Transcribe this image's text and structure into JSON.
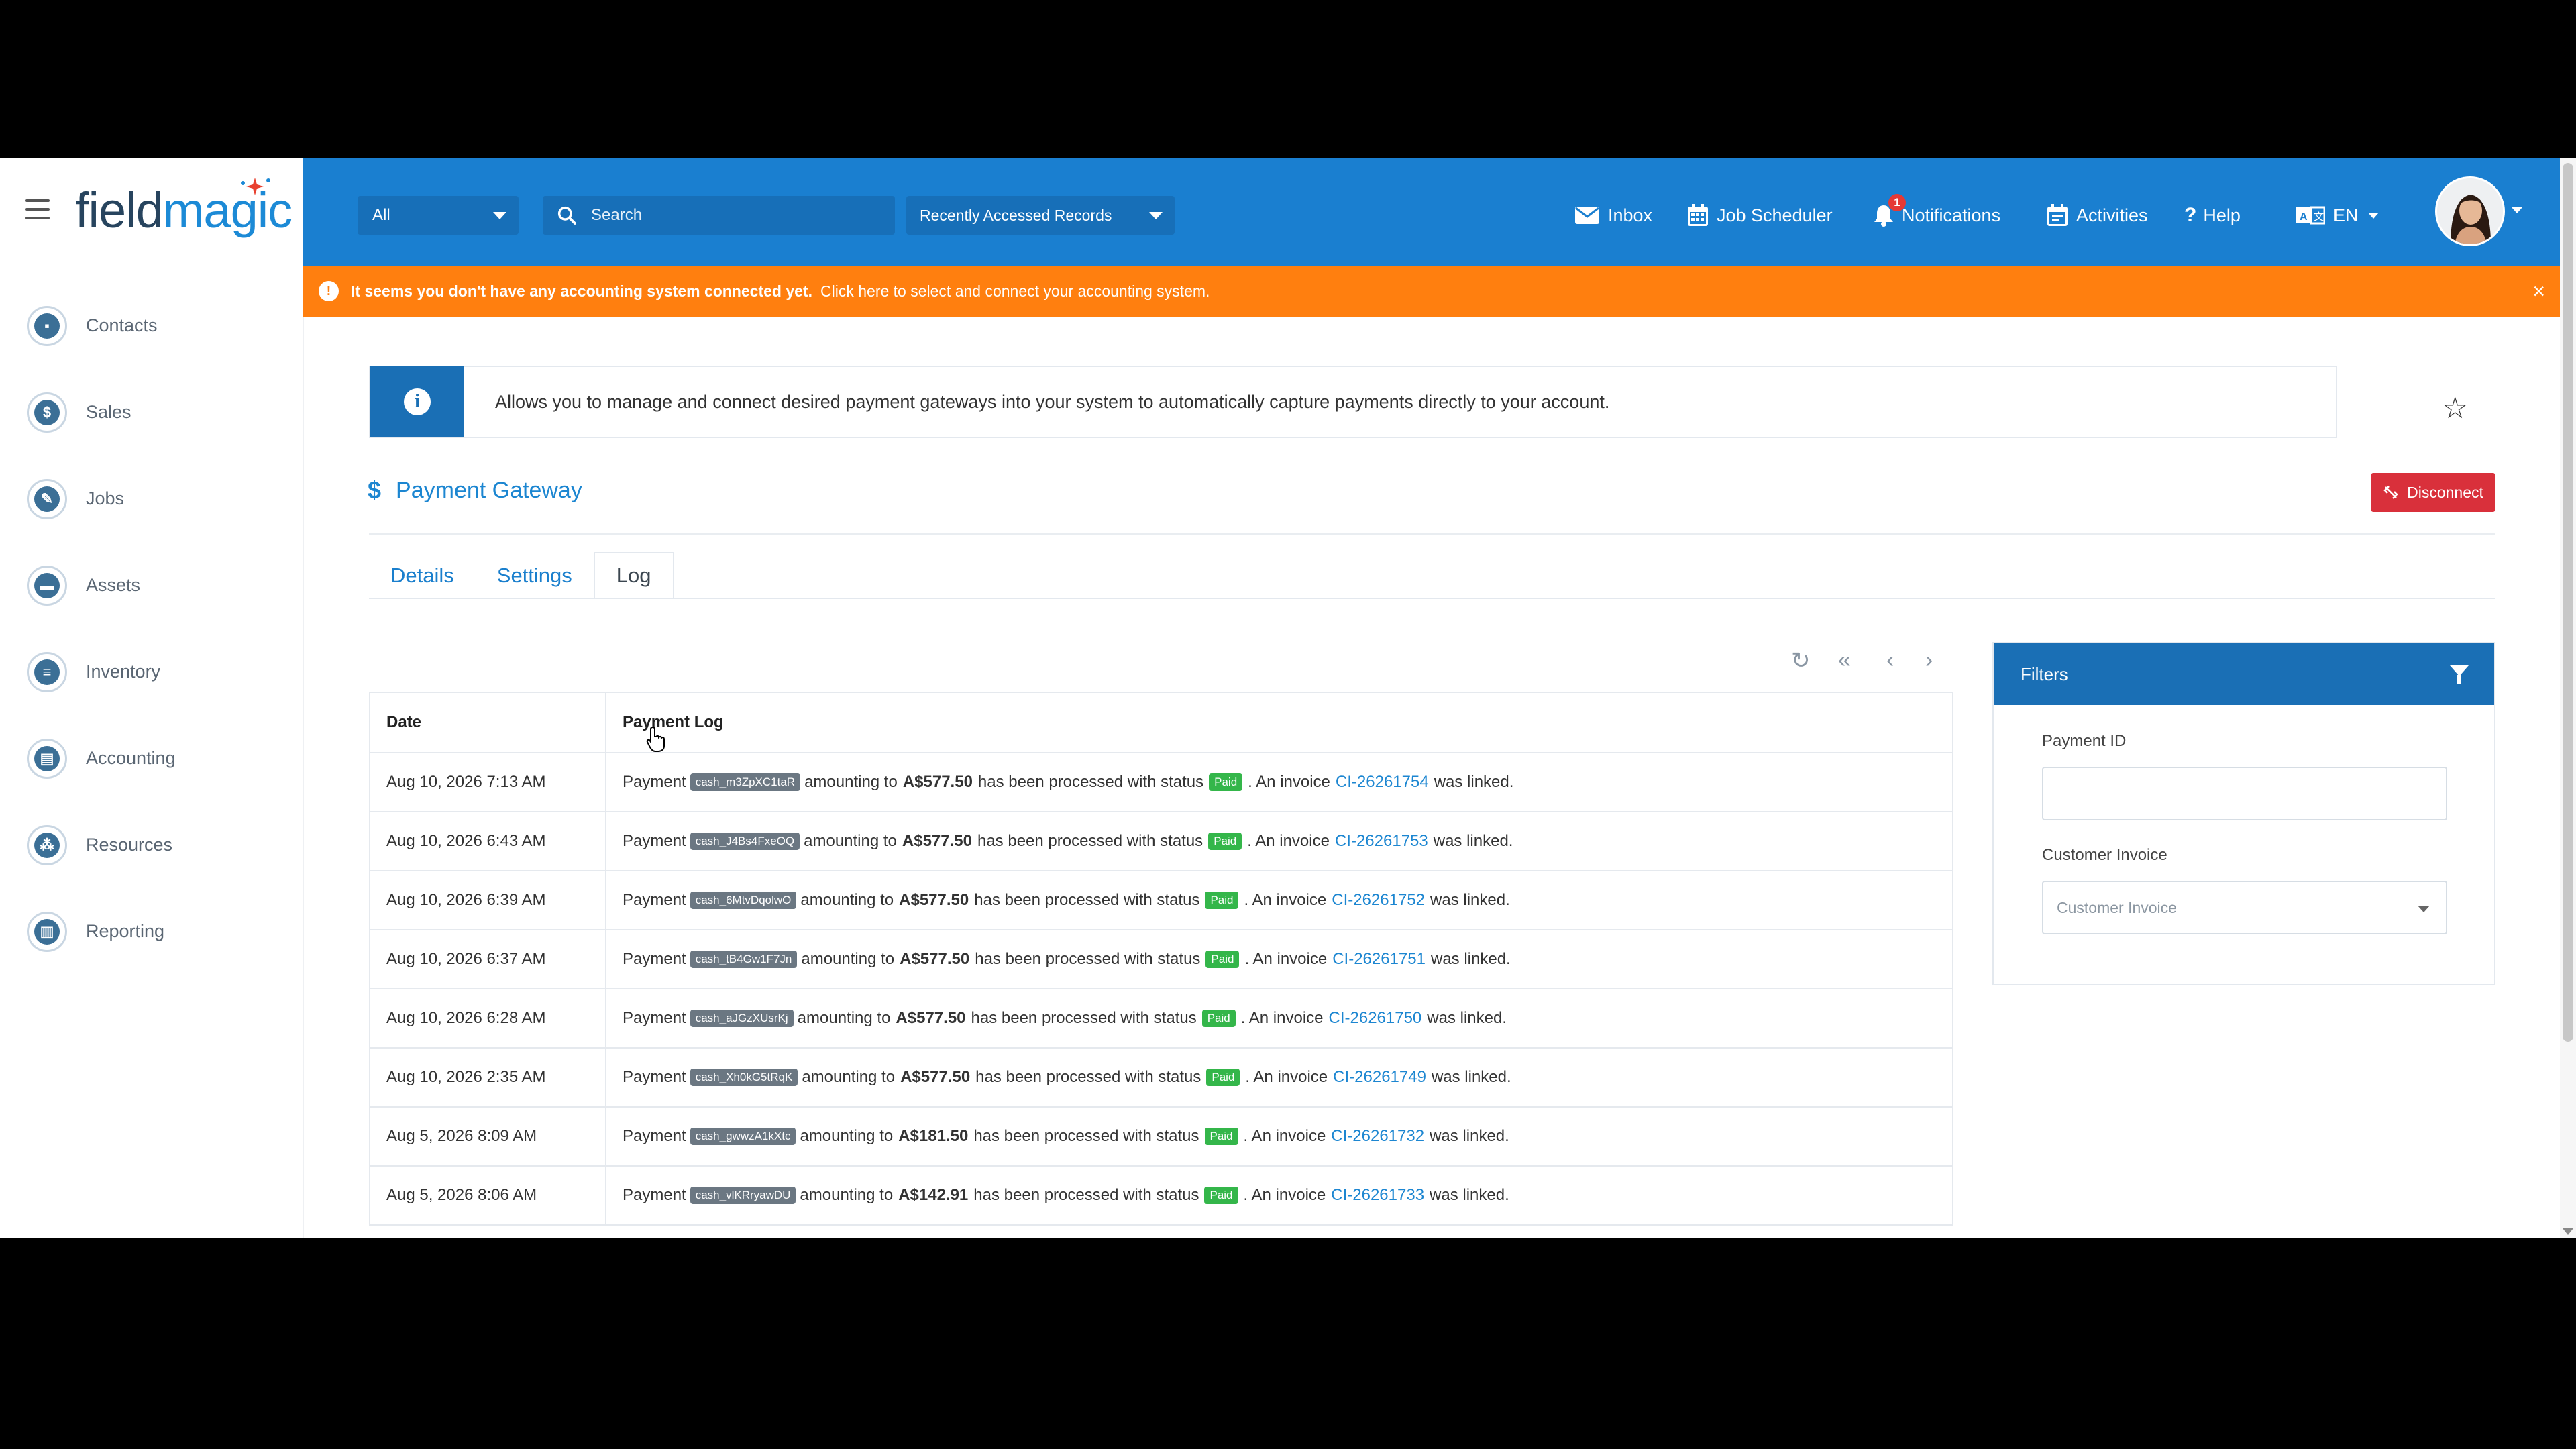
{
  "brand": {
    "logo_part1": "field",
    "logo_part2": "magic"
  },
  "sidebar": {
    "items": [
      {
        "label": "Contacts",
        "icon": "contacts-icon",
        "glyph": "▪"
      },
      {
        "label": "Sales",
        "icon": "dollar-icon",
        "glyph": "$"
      },
      {
        "label": "Jobs",
        "icon": "wrench-icon",
        "glyph": "✎"
      },
      {
        "label": "Assets",
        "icon": "briefcase-icon",
        "glyph": "▬"
      },
      {
        "label": "Inventory",
        "icon": "inventory-icon",
        "glyph": "≡"
      },
      {
        "label": "Accounting",
        "icon": "accounting-icon",
        "glyph": "▤"
      },
      {
        "label": "Resources",
        "icon": "resources-icon",
        "glyph": "⁂"
      },
      {
        "label": "Reporting",
        "icon": "reporting-icon",
        "glyph": "▥"
      }
    ]
  },
  "topbar": {
    "scope_select": "All",
    "search_placeholder": "Search",
    "recent_label": "Recently Accessed Records",
    "inbox": "Inbox",
    "job_scheduler": "Job Scheduler",
    "notifications": "Notifications",
    "notifications_count": "1",
    "activities": "Activities",
    "help": "Help",
    "language": "EN"
  },
  "alert": {
    "bold_text": "It seems you don't have any accounting system connected yet.",
    "link_text": "Click here to select and connect your accounting system.",
    "close": "×"
  },
  "info": {
    "text": "Allows you to manage and connect desired payment gateways into your system to automatically capture payments directly to your account."
  },
  "page": {
    "title": "Payment Gateway",
    "disconnect_label": "Disconnect"
  },
  "tabs": [
    {
      "label": "Details"
    },
    {
      "label": "Settings"
    },
    {
      "label": "Log"
    }
  ],
  "log_table": {
    "headers": {
      "date": "Date",
      "log": "Payment Log"
    },
    "rows": [
      {
        "date": "Aug 10, 2026 7:13 AM",
        "prefix": "Payment",
        "code": "cash_m3ZpXC1taR",
        "mid": "amounting to",
        "amount": "A$577.50",
        "status_text": "has been processed with status",
        "status": "Paid",
        "inv_text": ". An invoice",
        "invoice": "CI-26261754",
        "suffix": "was linked."
      },
      {
        "date": "Aug 10, 2026 6:43 AM",
        "prefix": "Payment",
        "code": "cash_J4Bs4FxeOQ",
        "mid": "amounting to",
        "amount": "A$577.50",
        "status_text": "has been processed with status",
        "status": "Paid",
        "inv_text": ". An invoice",
        "invoice": "CI-26261753",
        "suffix": "was linked."
      },
      {
        "date": "Aug 10, 2026 6:39 AM",
        "prefix": "Payment",
        "code": "cash_6MtvDqolwO",
        "mid": "amounting to",
        "amount": "A$577.50",
        "status_text": "has been processed with status",
        "status": "Paid",
        "inv_text": ". An invoice",
        "invoice": "CI-26261752",
        "suffix": "was linked."
      },
      {
        "date": "Aug 10, 2026 6:37 AM",
        "prefix": "Payment",
        "code": "cash_tB4Gw1F7Jn",
        "mid": "amounting to",
        "amount": "A$577.50",
        "status_text": "has been processed with status",
        "status": "Paid",
        "inv_text": ". An invoice",
        "invoice": "CI-26261751",
        "suffix": "was linked."
      },
      {
        "date": "Aug 10, 2026 6:28 AM",
        "prefix": "Payment",
        "code": "cash_aJGzXUsrKj",
        "mid": "amounting to",
        "amount": "A$577.50",
        "status_text": "has been processed with status",
        "status": "Paid",
        "inv_text": ". An invoice",
        "invoice": "CI-26261750",
        "suffix": "was linked."
      },
      {
        "date": "Aug 10, 2026 2:35 AM",
        "prefix": "Payment",
        "code": "cash_Xh0kG5tRqK",
        "mid": "amounting to",
        "amount": "A$577.50",
        "status_text": "has been processed with status",
        "status": "Paid",
        "inv_text": ". An invoice",
        "invoice": "CI-26261749",
        "suffix": "was linked."
      },
      {
        "date": "Aug 5, 2026 8:09 AM",
        "prefix": "Payment",
        "code": "cash_gwwzA1kXtc",
        "mid": "amounting to",
        "amount": "A$181.50",
        "status_text": "has been processed with status",
        "status": "Paid",
        "inv_text": ". An invoice",
        "invoice": "CI-26261732",
        "suffix": "was linked."
      },
      {
        "date": "Aug 5, 2026 8:06 AM",
        "prefix": "Payment",
        "code": "cash_vlKRryawDU",
        "mid": "amounting to",
        "amount": "A$142.91",
        "status_text": "has been processed with status",
        "status": "Paid",
        "inv_text": ". An invoice",
        "invoice": "CI-26261733",
        "suffix": "was linked."
      }
    ]
  },
  "filters": {
    "title": "Filters",
    "payment_id_label": "Payment ID",
    "payment_id_value": "",
    "customer_invoice_label": "Customer Invoice",
    "customer_invoice_placeholder": "Customer Invoice"
  },
  "colors": {
    "topbar": "#1a7fd0",
    "alert": "#ff7f0f",
    "disconnect": "#d9303b",
    "link": "#1c86d1",
    "paid": "#34b64a"
  }
}
